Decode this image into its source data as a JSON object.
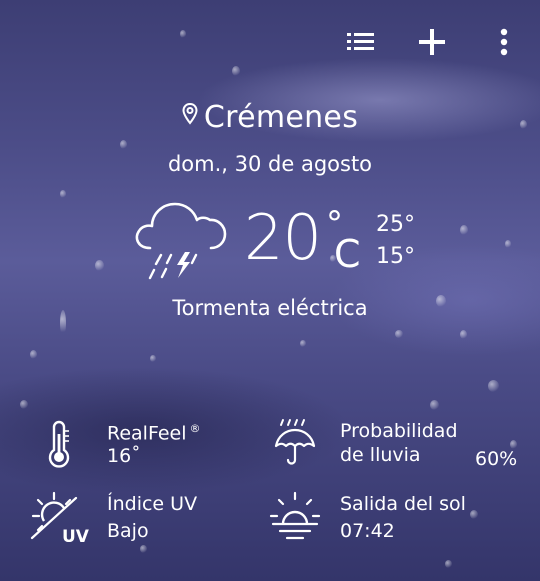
{
  "toolbar": {
    "list_icon": "list-icon",
    "add_icon": "plus-icon",
    "menu_icon": "more-vert-icon"
  },
  "location": {
    "name": "Crémenes",
    "icon": "location-pin-icon"
  },
  "date": "dom., 30 de agosto",
  "current": {
    "icon": "thunderstorm-rain-icon",
    "temperature": "20",
    "degree_symbol": "°",
    "unit": "C",
    "high": "25°",
    "low": "15°",
    "condition": "Tormenta eléctrica"
  },
  "details": {
    "realfeel": {
      "label": "RealFeel",
      "mark": "®",
      "value": "16˚",
      "icon": "thermometer-icon"
    },
    "rain": {
      "label_line1": "Probabilidad",
      "label_line2": "de lluvia",
      "value": "60%",
      "icon": "umbrella-rain-icon"
    },
    "uv": {
      "label": "Índice UV",
      "value": "Bajo",
      "icon": "uv-sun-icon",
      "icon_text": "UV"
    },
    "sunrise": {
      "label": "Salida del sol",
      "value": "07:42",
      "icon": "sunrise-icon"
    }
  }
}
